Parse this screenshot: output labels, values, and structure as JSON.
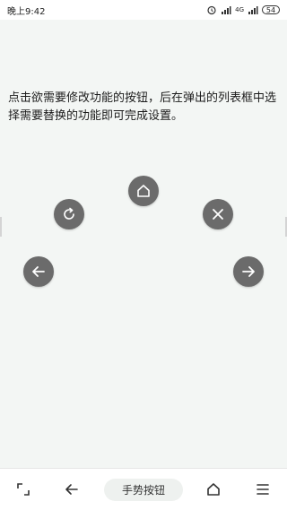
{
  "status_bar": {
    "time": "晚上9:42",
    "network_label": "4G",
    "battery_level": "54"
  },
  "main": {
    "instruction": "点击欲需要修改功能的按钮，后在弹出的列表框中选择需要替换的功能即可完成设置。",
    "buttons": [
      {
        "icon": "home-icon"
      },
      {
        "icon": "refresh-icon"
      },
      {
        "icon": "close-icon"
      },
      {
        "icon": "arrow-left-icon"
      },
      {
        "icon": "arrow-right-icon"
      }
    ]
  },
  "nav_bar": {
    "gesture_label": "手势按钮",
    "items": [
      {
        "icon": "corner-brackets-icon"
      },
      {
        "icon": "back-arrow-icon"
      },
      {
        "icon": "home-outline-icon"
      },
      {
        "icon": "menu-icon"
      }
    ]
  },
  "colors": {
    "background": "#f3f6f4",
    "button_fill": "#6b6b6b",
    "icon": "#ffffff"
  }
}
